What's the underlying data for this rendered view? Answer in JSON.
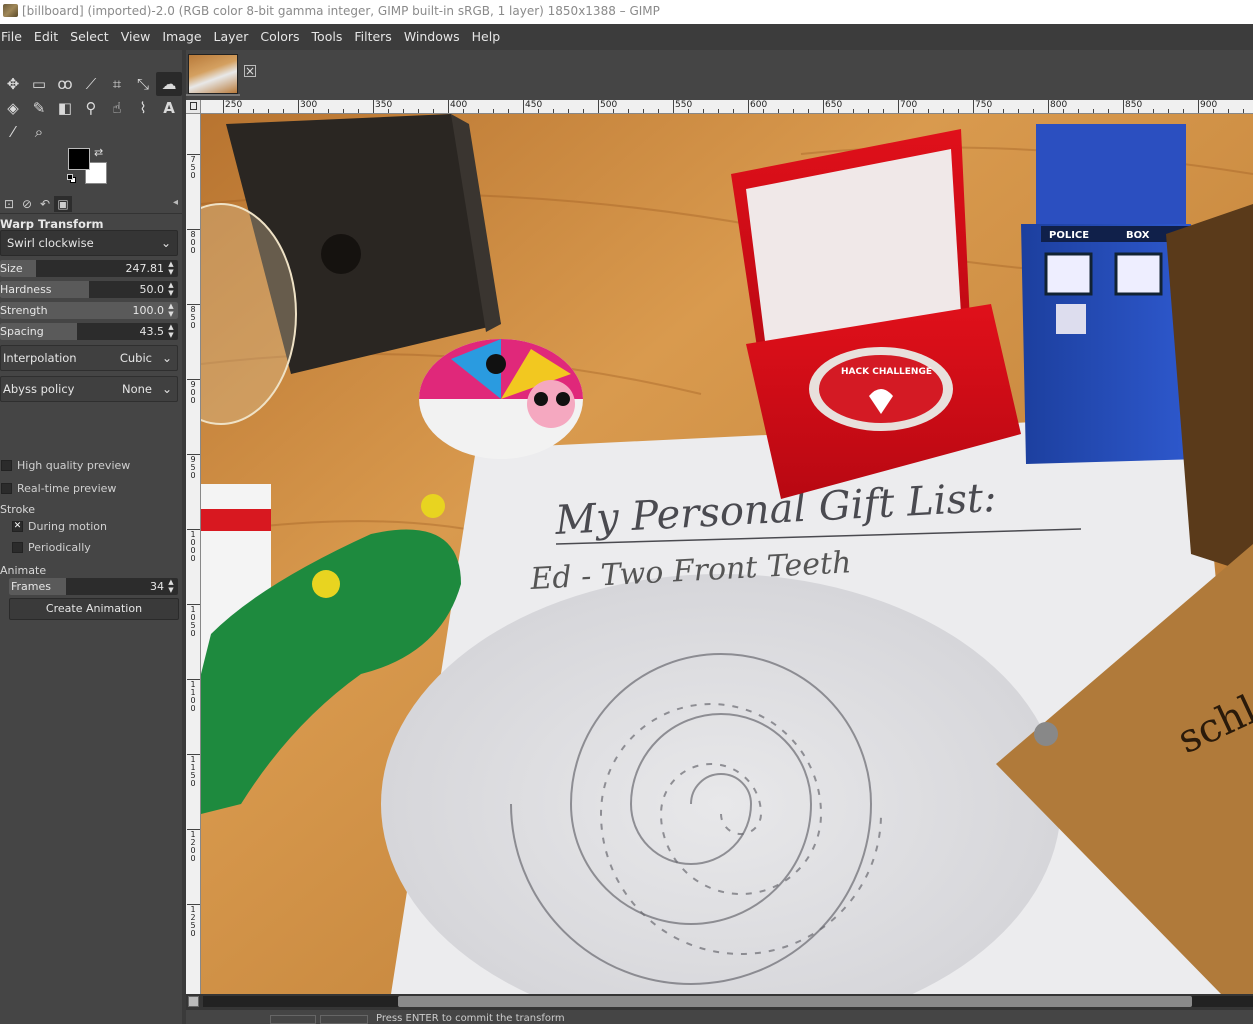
{
  "window": {
    "title": "[billboard] (imported)-2.0 (RGB color 8-bit gamma integer, GIMP built-in sRGB, 1 layer) 1850x1388 – GIMP"
  },
  "menu": [
    "File",
    "Edit",
    "Select",
    "View",
    "Image",
    "Layer",
    "Colors",
    "Tools",
    "Filters",
    "Windows",
    "Help"
  ],
  "tool_options": {
    "title": "Warp Transform",
    "behavior": "Swirl clockwise",
    "size": {
      "label": "Size",
      "value": "247.81",
      "fraction": 0.2
    },
    "hardness": {
      "label": "Hardness",
      "value": "50.0",
      "fraction": 0.5
    },
    "strength": {
      "label": "Strength",
      "value": "100.0",
      "fraction": 1.0
    },
    "spacing": {
      "label": "Spacing",
      "value": "43.5",
      "fraction": 0.43
    },
    "interpolation": {
      "label": "Interpolation",
      "value": "Cubic"
    },
    "abyss": {
      "label": "Abyss policy",
      "value": "None"
    },
    "hq_preview": "High quality preview",
    "rt_preview": "Real-time preview",
    "stroke_label": "Stroke",
    "during_motion": "During motion",
    "periodically": "Periodically",
    "animate_label": "Animate",
    "frames": {
      "label": "Frames",
      "value": "34",
      "fraction": 0.34
    },
    "create_animation": "Create Animation"
  },
  "ruler": {
    "h_labels": [
      "250",
      "300",
      "350",
      "400",
      "450",
      "500",
      "550",
      "600",
      "650",
      "700",
      "750",
      "800",
      "850",
      "900"
    ],
    "v_labels": [
      "750",
      "800",
      "850",
      "900",
      "950",
      "1000",
      "1050",
      "1100",
      "1150",
      "1200",
      "1250"
    ]
  },
  "image_text": {
    "heading": "My Personal Gift List:",
    "item1": "Ed - Two Front Teeth",
    "police": "POLICE",
    "box": "BOX",
    "coin": "HACK CHALLENGE",
    "sign": "schl"
  },
  "statusbar": {
    "message": "Press ENTER to commit the transform"
  },
  "colors": {
    "fg": "#000000",
    "bg": "#ffffff"
  }
}
